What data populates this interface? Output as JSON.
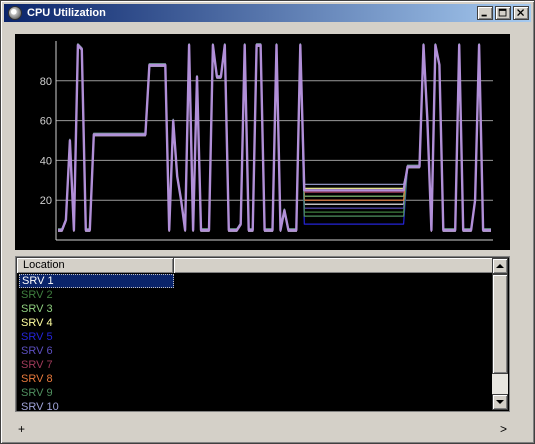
{
  "window": {
    "title": "CPU Utilization",
    "title_icon": "app-icon"
  },
  "titlebar_buttons": {
    "minimize_icon": "minimize-icon",
    "maximize_icon": "maximize-icon",
    "close_icon": "close-icon"
  },
  "colors": {
    "grid": "#9a9a9a",
    "axis": "#d0d0d0",
    "tick_text": "#d0d0d0",
    "selection": "#0a246a"
  },
  "list": {
    "column_header": "Location",
    "rows": [
      {
        "label": "SRV 1",
        "color": "#ffffff",
        "selected": true
      },
      {
        "label": "SRV 2",
        "color": "#3f7f3f",
        "selected": false
      },
      {
        "label": "SRV 3",
        "color": "#8fcf7f",
        "selected": false
      },
      {
        "label": "SRV 4",
        "color": "#ffffa0",
        "selected": false
      },
      {
        "label": "SRV 5",
        "color": "#2424d8",
        "selected": false
      },
      {
        "label": "SRV 6",
        "color": "#5c4fc0",
        "selected": false
      },
      {
        "label": "SRV 7",
        "color": "#a03a5a",
        "selected": false
      },
      {
        "label": "SRV 8",
        "color": "#e87a3c",
        "selected": false
      },
      {
        "label": "SRV 9",
        "color": "#4f8f5f",
        "selected": false
      },
      {
        "label": "SRV 10",
        "color": "#9fa3d8",
        "selected": false
      }
    ]
  },
  "status_bar": {
    "left_glyph": "+",
    "right_glyph": ">"
  },
  "chart_data": {
    "type": "line",
    "title": "",
    "xlabel": "",
    "ylabel": "",
    "ylim": [
      0,
      100
    ],
    "yticks": [
      "20",
      "40",
      "60",
      "80"
    ],
    "grid": true,
    "main_series": {
      "values": [
        5,
        5,
        10,
        50,
        5,
        98,
        96,
        5,
        5,
        53,
        53,
        53,
        53,
        53,
        53,
        53,
        53,
        53,
        53,
        53,
        53,
        53,
        53,
        88,
        88,
        88,
        88,
        88,
        5,
        60,
        32,
        20,
        5,
        98,
        5,
        82,
        5,
        5,
        5,
        98,
        82,
        82,
        98,
        5,
        5,
        5,
        8,
        98,
        5,
        5,
        98,
        98,
        5,
        5,
        5,
        98,
        5,
        15,
        5,
        5,
        5,
        98,
        5,
        5,
        5,
        5,
        5,
        5,
        5,
        5,
        5,
        5,
        5,
        5,
        5,
        5,
        5,
        5,
        5,
        5,
        5,
        5,
        5,
        5,
        5,
        5,
        5,
        5,
        37,
        37,
        37,
        37,
        98,
        60,
        5,
        98,
        88,
        5,
        5,
        5,
        5,
        98,
        5,
        5,
        5,
        20,
        98,
        5,
        5,
        5
      ]
    },
    "series": [
      {
        "name": "SRV 1",
        "color": "#ffffff",
        "plateau": 18
      },
      {
        "name": "SRV 2",
        "color": "#3f7f3f",
        "plateau": 14
      },
      {
        "name": "SRV 3",
        "color": "#8fcf7f",
        "plateau": 22
      },
      {
        "name": "SRV 4",
        "color": "#ffffa0",
        "plateau": 26
      },
      {
        "name": "SRV 5",
        "color": "#2424d8",
        "plateau": 8
      },
      {
        "name": "SRV 6",
        "color": "#5c4fc0",
        "plateau": 16
      },
      {
        "name": "SRV 7",
        "color": "#a03a5a",
        "plateau": 24
      },
      {
        "name": "SRV 8",
        "color": "#e87a3c",
        "plateau": 20
      },
      {
        "name": "SRV 9",
        "color": "#4f8f5f",
        "plateau": 12
      },
      {
        "name": "SRV 10",
        "color": "#9fa3d8",
        "plateau": 28
      }
    ]
  }
}
